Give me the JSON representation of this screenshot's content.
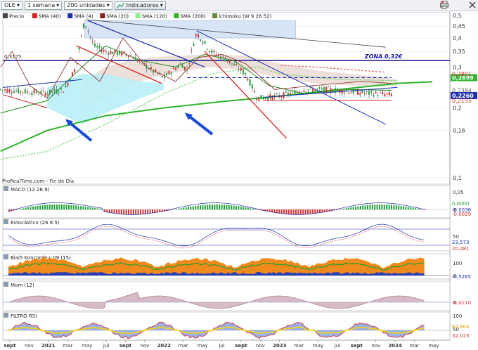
{
  "toolbar": {
    "symbol": "OLE",
    "period": "1 semana",
    "units": "200 unidades",
    "indicators": "Indicadores",
    "arrow": "▾",
    "print_icon": "printer-icon",
    "close_icon": "close-icon"
  },
  "colors": {
    "up": "#22a33a",
    "down": "#d63333",
    "blue": "#1e2fb0",
    "sma200": "#2db52d",
    "sma120": "#8ef08e",
    "cloud": "#c7dbf5",
    "accent": "#000080"
  },
  "chart_data": [
    {
      "type": "candlestick",
      "title": "Precio",
      "legend": [
        {
          "label": "Precio",
          "color": "#444444"
        },
        {
          "label": "SMA (40)",
          "color": "#d82020"
        },
        {
          "label": "SMA (4)",
          "color": "#1e2fb0"
        },
        {
          "label": "SMA (20)",
          "color": "#8a1f1f"
        },
        {
          "label": "SMA (120)",
          "color": "#8ef08e"
        },
        {
          "label": "SMA (200)",
          "color": "#2db52d"
        },
        {
          "label": "Ichimoku (W 9 26 52)",
          "color": "#6a8a3a"
        }
      ],
      "y_scale": "log",
      "ylim": [
        0.1,
        0.5
      ],
      "y_ticks": [
        "0,5",
        "0,45",
        "0,4",
        "0,35",
        "0,3",
        "0,2",
        "0,16",
        "0,1"
      ],
      "x_ticks": [
        "sept",
        "nov",
        "2021",
        "mar",
        "may",
        "jul",
        "sept",
        "nov",
        "2022",
        "mar",
        "may",
        "jul",
        "sept",
        "nov",
        "2023",
        "mar",
        "may",
        "jul",
        "sept",
        "nov",
        "2024",
        "mar",
        "may"
      ],
      "close_path": [
        [
          2020.6,
          0.24
        ],
        [
          2020.8,
          0.235
        ],
        [
          2021.0,
          0.232
        ],
        [
          2021.15,
          0.24
        ],
        [
          2021.25,
          0.3
        ],
        [
          2021.32,
          0.47
        ],
        [
          2021.4,
          0.37
        ],
        [
          2021.5,
          0.35
        ],
        [
          2021.7,
          0.34
        ],
        [
          2021.9,
          0.29
        ],
        [
          2022.0,
          0.27
        ],
        [
          2022.15,
          0.31
        ],
        [
          2022.2,
          0.29
        ],
        [
          2022.28,
          0.42
        ],
        [
          2022.4,
          0.35
        ],
        [
          2022.55,
          0.32
        ],
        [
          2022.7,
          0.28
        ],
        [
          2022.8,
          0.22
        ],
        [
          2023.0,
          0.225
        ],
        [
          2023.2,
          0.24
        ],
        [
          2023.4,
          0.24
        ],
        [
          2023.6,
          0.235
        ],
        [
          2023.8,
          0.23
        ],
        [
          2023.95,
          0.228
        ]
      ],
      "sma200_path": [
        [
          2020.6,
          0.13
        ],
        [
          2021.0,
          0.16
        ],
        [
          2021.5,
          0.185
        ],
        [
          2022.0,
          0.2
        ],
        [
          2022.5,
          0.213
        ],
        [
          2023.0,
          0.225
        ],
        [
          2023.5,
          0.24
        ],
        [
          2024.0,
          0.255
        ],
        [
          2024.3,
          0.259
        ]
      ],
      "price_labels": [
        {
          "text": "0,2699",
          "value": 0.2699,
          "bg": "#2db52d",
          "color": "#ffffff"
        },
        {
          "text": "0,2801",
          "value": 0.2801,
          "bg": "",
          "color": "#d63333"
        },
        {
          "text": "0,2384",
          "value": 0.2384,
          "bg": "",
          "color": "#666666"
        },
        {
          "text": "0,2260",
          "value": 0.226,
          "bg": "#1e2fb0",
          "color": "#ffffff"
        },
        {
          "text": "0,2155",
          "value": 0.2155,
          "bg": "",
          "color": "#d63333"
        }
      ],
      "annotations": {
        "zone_label": "ZONA 0,32€",
        "zone_value": 0.32,
        "level_label": "0,3175",
        "source": "ProRealTime.com - Fin de Día"
      }
    },
    {
      "type": "histogram",
      "title": "MACD (12 26 9)",
      "y_ticks": [
        "0,05",
        "0"
      ],
      "value_labels": [
        {
          "text": "0,0000",
          "color": "#22a33a"
        },
        {
          "text": "-0,0036",
          "color": "#1e2fb0"
        },
        {
          "text": "-0,0029",
          "color": "#d63333"
        }
      ]
    },
    {
      "type": "line",
      "title": "Estocástico (26 8 5)",
      "y_ticks": [
        "50"
      ],
      "value_labels": [
        {
          "text": "23,573",
          "color": "#1e2fb0"
        },
        {
          "text": "20,481",
          "color": "#d63333"
        }
      ]
    },
    {
      "type": "area",
      "title": "Blai5 Koncorde v.09 (15)",
      "y_ticks": [
        "100",
        "0"
      ],
      "value_labels": [
        {
          "text": "-0,5265",
          "color": "#1e2fb0"
        }
      ]
    },
    {
      "type": "area",
      "title": "Mom (12)",
      "y_ticks": [
        "0"
      ],
      "value_labels": [
        {
          "text": "-0,0110",
          "color": "#d63333"
        }
      ]
    },
    {
      "type": "area",
      "title": "FILTRO RSI",
      "y_ticks": [
        "100",
        "50"
      ],
      "value_labels": [
        {
          "text": "62,804",
          "color": "#e0a000"
        },
        {
          "text": "32,023",
          "color": "#d63333"
        }
      ]
    }
  ]
}
